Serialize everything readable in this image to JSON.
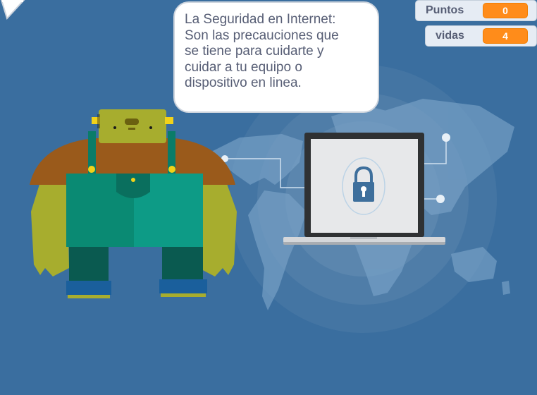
{
  "monitors": {
    "score": {
      "label": "Puntos",
      "value": "0"
    },
    "lives": {
      "label": "vidas",
      "value": "4"
    }
  },
  "speech_bubble": {
    "text": "La Seguridad en Internet:\nSon las precauciones que\nse tiene para cuidarte y\ncuidar a tu equipo o\ndispositivo en linea."
  },
  "colors": {
    "stage_background": "#3a6e9f",
    "monitor_value": "#ff8c1a",
    "monster_skin": "#a7ad2e",
    "monster_overalls": "#0d9b86"
  },
  "icons": [
    "padlock-icon"
  ]
}
